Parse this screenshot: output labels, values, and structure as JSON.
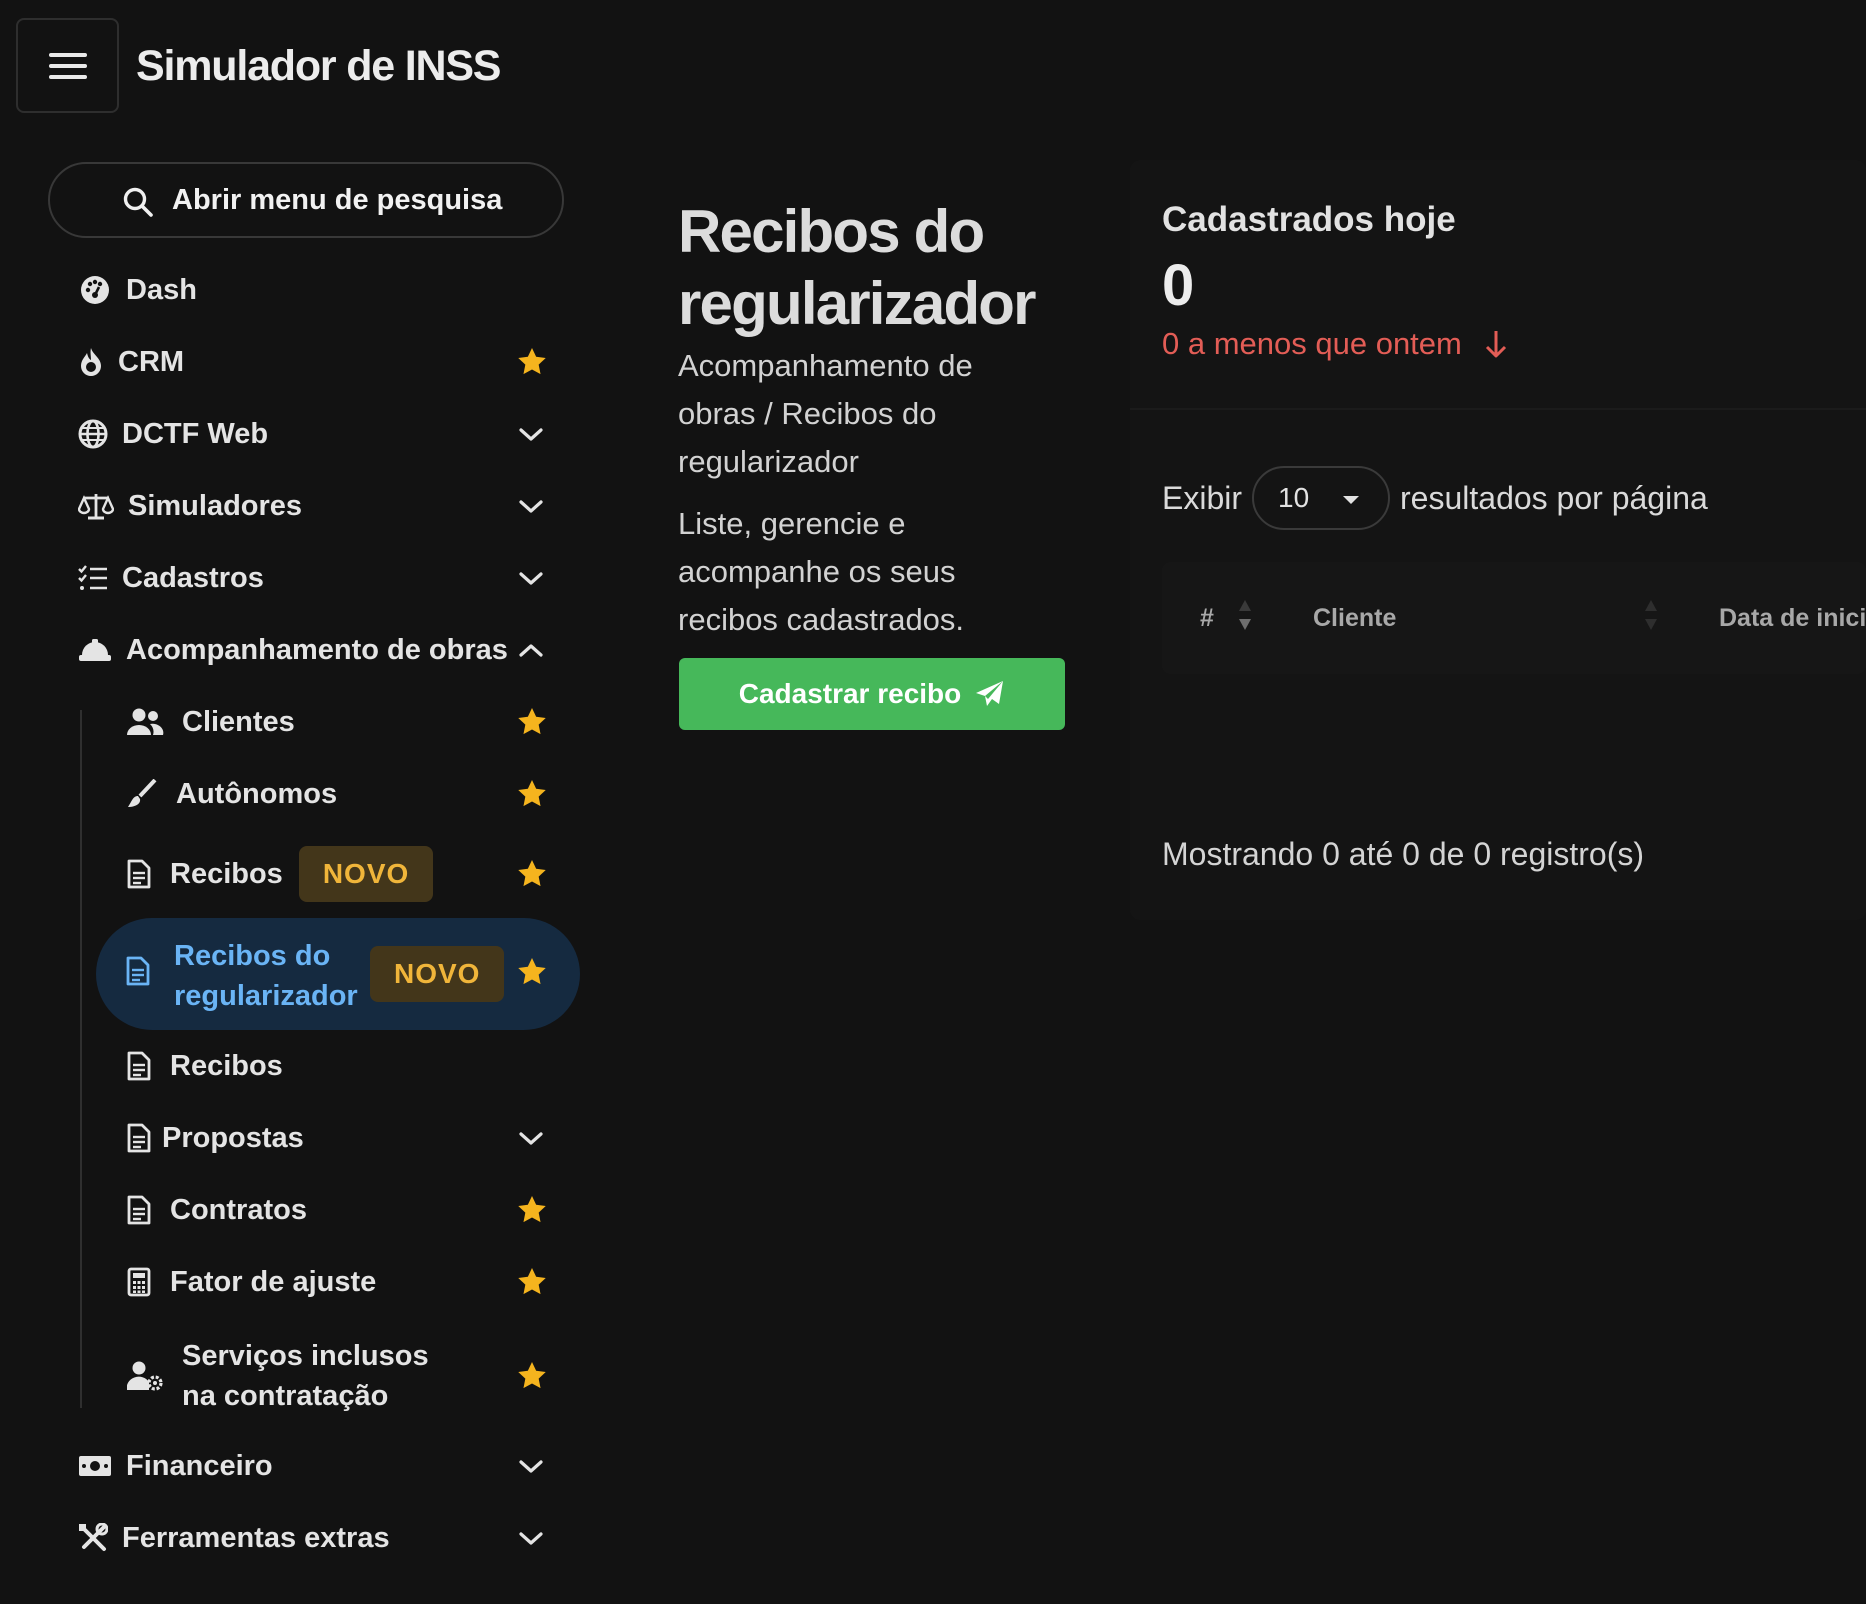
{
  "header": {
    "app_title": "Simulador de INSS",
    "menu_icon": "hamburger-icon"
  },
  "sidebar": {
    "search_label": "Abrir menu de pesquisa",
    "items": [
      {
        "label": "Dash",
        "icon": "dashboard-icon"
      },
      {
        "label": "CRM",
        "icon": "fire-icon",
        "starred": true
      },
      {
        "label": "DCTF Web",
        "icon": "globe-icon",
        "expandable": true
      },
      {
        "label": "Simuladores",
        "icon": "scale-icon",
        "expandable": true
      },
      {
        "label": "Cadastros",
        "icon": "checklist-icon",
        "expandable": true
      },
      {
        "label": "Acompanhamento de obras",
        "icon": "hard-hat-icon",
        "expanded": true
      },
      {
        "label": "Financeiro",
        "icon": "money-icon",
        "expandable": true
      },
      {
        "label": "Ferramentas extras",
        "icon": "tools-icon",
        "expandable": true
      }
    ],
    "subitems": [
      {
        "label": "Clientes",
        "icon": "users-icon",
        "starred": true
      },
      {
        "label": "Autônomos",
        "icon": "brush-icon",
        "starred": true
      },
      {
        "label": "Recibos",
        "icon": "document-icon",
        "badge": "NOVO",
        "starred": true
      },
      {
        "label": "Recibos do regularizador",
        "icon": "document-icon",
        "badge": "NOVO",
        "starred": true,
        "active": true
      },
      {
        "label": "Recibos",
        "icon": "document-icon"
      },
      {
        "label": "Propostas",
        "icon": "document-icon",
        "expandable": true
      },
      {
        "label": "Contratos",
        "icon": "document-icon",
        "starred": true
      },
      {
        "label": "Fator de ajuste",
        "icon": "calculator-icon",
        "starred": true
      },
      {
        "label": "Serviços inclusos na contratação",
        "icon": "user-gear-icon",
        "starred": true
      }
    ]
  },
  "main": {
    "title": "Recibos do regularizador",
    "breadcrumb": "Acompanhamento de obras / Recibos do regularizador",
    "description": "Liste, gerencie e acompanhe os seus recibos cadastrados.",
    "cta_label": "Cadastrar recibo"
  },
  "stats": {
    "title": "Cadastrados hoje",
    "value": "0",
    "delta_text": "0 a menos que ontem"
  },
  "table": {
    "show_label": "Exibir",
    "page_size": "10",
    "per_page_label": "resultados por página",
    "columns": [
      "#",
      "Cliente",
      "Data de inici"
    ],
    "footer": "Mostrando 0 até 0 de 0 registro(s)"
  },
  "colors": {
    "background": "#121212",
    "accent_green": "#46b85a",
    "active_blue": "#6ab4f5",
    "active_bg": "#152a40",
    "badge_text": "#f0b53a",
    "star": "#f5b41e",
    "negative": "#e35d56"
  }
}
